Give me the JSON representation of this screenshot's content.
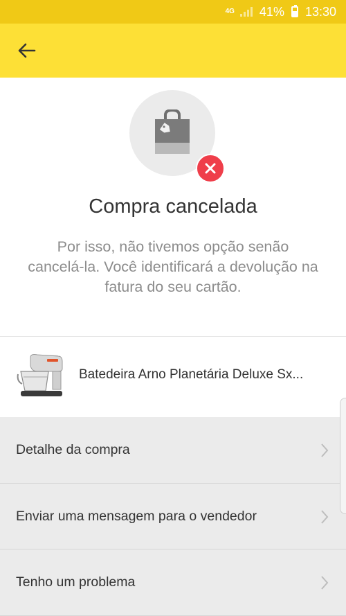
{
  "status_bar": {
    "network": "4G",
    "battery": "41%",
    "time": "13:30"
  },
  "colors": {
    "app_bar": "#fde036",
    "status_bar": "#f0c916",
    "cancel_badge": "#ef3e4a"
  },
  "header": {
    "back_icon": "arrow-left-icon"
  },
  "status": {
    "icon": "shopping-bag-icon",
    "badge_icon": "close-icon",
    "title": "Compra cancelada",
    "message": "Por isso, não tivemos opção senão cancelá-la. Você identificará a devolução na fatura do seu cartão."
  },
  "product": {
    "name": "Batedeira Arno Planetária Deluxe Sx..."
  },
  "actions": [
    {
      "label": "Detalhe da compra"
    },
    {
      "label": "Enviar uma mensagem para o vendedor"
    },
    {
      "label": "Tenho um problema"
    }
  ]
}
